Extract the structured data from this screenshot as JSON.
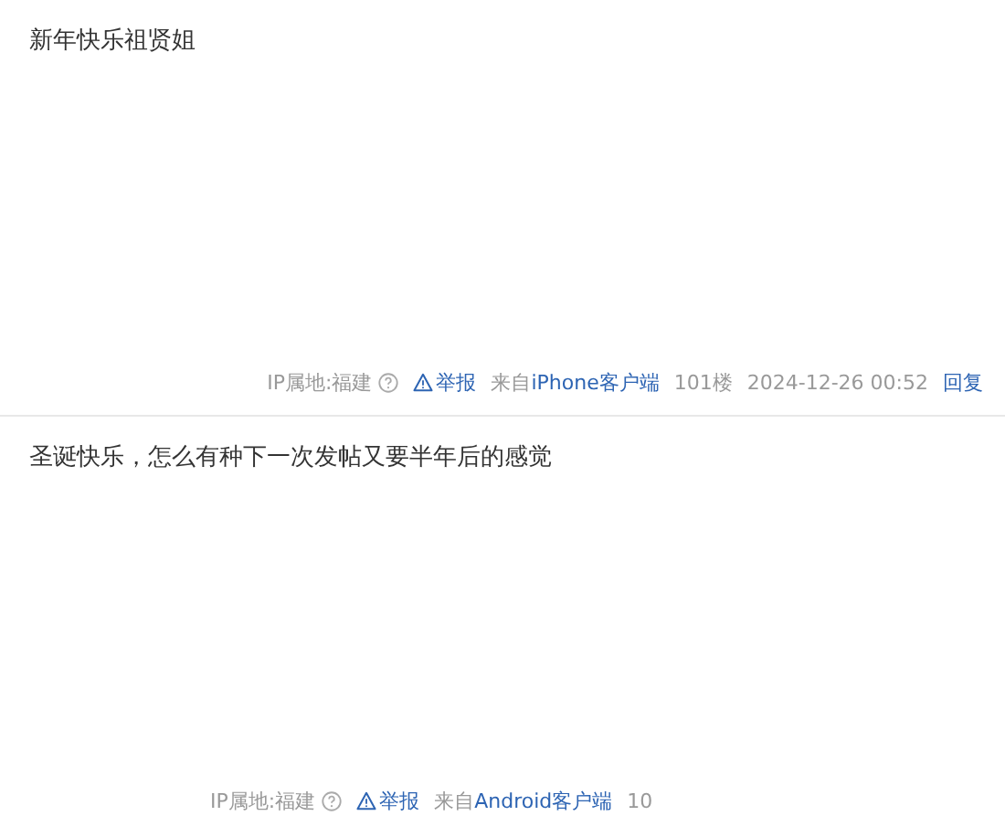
{
  "posts": [
    {
      "content": "新年快乐祖贤姐",
      "footer": {
        "ip_location": "IP属地:福建",
        "report": "举报",
        "source_prefix": "来自",
        "source": "iPhone客户端",
        "floor": "101楼",
        "time": "2024-12-26 00:52",
        "reply": "回复"
      }
    },
    {
      "content": "圣诞快乐，怎么有种下一次发帖又要半年后的感觉",
      "footer": {
        "ip_location": "IP属地:福建",
        "report": "举报",
        "source_prefix": "来自",
        "source": "Android客户端",
        "floor": "10"
      }
    }
  ]
}
